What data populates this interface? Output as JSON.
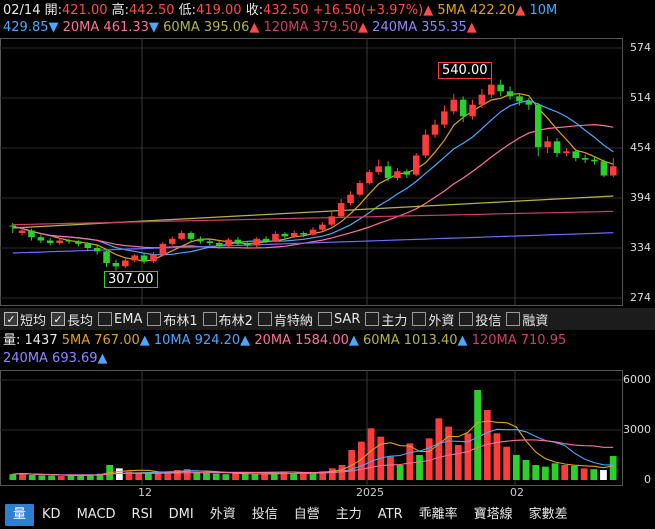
{
  "header": {
    "date": "02/14",
    "open_label": "開:",
    "open": "421.00",
    "high_label": "高:",
    "high": "442.50",
    "low_label": "低:",
    "low": "419.00",
    "close_label": "收:",
    "close": "432.50",
    "change": "+16.50(+3.97%)",
    "ma5": "5MA 422.20",
    "ma10_a": "10M",
    "ma10_b": "429.85",
    "ma20": "20MA 461.33",
    "ma60": "60MA 395.06",
    "ma120": "120MA 379.50",
    "ma240": "240MA 355.35",
    "up_arrow": "▲",
    "down_arrow": "▼"
  },
  "price_axis": [
    "574",
    "514",
    "454",
    "394",
    "334",
    "274"
  ],
  "annotations": {
    "high_mark": "540.00",
    "low_mark": "307.00"
  },
  "indicator_toggles": [
    {
      "label": "短均",
      "checked": true
    },
    {
      "label": "長均",
      "checked": true
    },
    {
      "label": "EMA",
      "checked": false
    },
    {
      "label": "布林1",
      "checked": false
    },
    {
      "label": "布林2",
      "checked": false
    },
    {
      "label": "肯特納",
      "checked": false
    },
    {
      "label": "SAR",
      "checked": false
    },
    {
      "label": "主力",
      "checked": false
    },
    {
      "label": "外資",
      "checked": false
    },
    {
      "label": "投信",
      "checked": false
    },
    {
      "label": "融資",
      "checked": false
    }
  ],
  "volume_header": {
    "vol": "量: 1437",
    "v5": "5MA 767.00",
    "v10": "10MA 924.20",
    "v20": "20MA 1584.00",
    "v60": "60MA 1013.40",
    "v120": "120MA 710.95",
    "v240": "240MA 693.69",
    "up_arrow": "▲"
  },
  "volume_axis": [
    "6000",
    "3000",
    "0"
  ],
  "x_axis": [
    "12",
    "2025",
    "02"
  ],
  "bottom_tabs": [
    "量",
    "KD",
    "MACD",
    "RSI",
    "DMI",
    "外資",
    "投信",
    "自營",
    "主力",
    "ATR",
    "乖離率",
    "寶塔線",
    "家數差"
  ],
  "colors": {
    "up": "#ff3b3b",
    "down": "#2bd12b",
    "ma5": "#e0a21a",
    "ma10": "#4aa8ff",
    "ma20": "#ff6fa0",
    "ma60": "#b5b24a",
    "ma120": "#d13c6b",
    "ma240": "#6b6bff",
    "accent_tab": "#2f7fd1"
  },
  "chart_data": {
    "type": "candlestick",
    "price_range": [
      274,
      574
    ],
    "candles": [
      [
        361,
        360,
        364,
        352
      ],
      [
        352,
        355,
        359,
        349
      ],
      [
        355,
        347,
        357,
        343
      ],
      [
        347,
        343,
        350,
        340
      ],
      [
        343,
        340,
        346,
        337
      ],
      [
        340,
        343,
        346,
        338
      ],
      [
        343,
        342,
        345,
        339
      ],
      [
        342,
        339,
        344,
        336
      ],
      [
        339,
        334,
        341,
        330
      ],
      [
        334,
        330,
        337,
        326
      ],
      [
        330,
        316,
        332,
        311
      ],
      [
        316,
        312,
        320,
        307
      ],
      [
        312,
        319,
        322,
        310
      ],
      [
        319,
        325,
        327,
        317
      ],
      [
        325,
        318,
        328,
        315
      ],
      [
        318,
        326,
        329,
        316
      ],
      [
        326,
        339,
        341,
        324
      ],
      [
        339,
        345,
        348,
        337
      ],
      [
        345,
        352,
        355,
        343
      ],
      [
        352,
        345,
        354,
        341
      ],
      [
        345,
        342,
        348,
        339
      ],
      [
        342,
        340,
        345,
        337
      ],
      [
        340,
        336,
        342,
        333
      ],
      [
        336,
        344,
        346,
        334
      ],
      [
        344,
        339,
        347,
        337
      ],
      [
        339,
        337,
        341,
        334
      ],
      [
        337,
        345,
        347,
        335
      ],
      [
        345,
        342,
        348,
        340
      ],
      [
        342,
        351,
        354,
        341
      ],
      [
        351,
        348,
        353,
        345
      ],
      [
        348,
        352,
        355,
        346
      ],
      [
        352,
        350,
        354,
        347
      ],
      [
        350,
        356,
        359,
        349
      ],
      [
        356,
        362,
        365,
        354
      ],
      [
        362,
        372,
        378,
        360
      ],
      [
        372,
        388,
        393,
        370
      ],
      [
        388,
        398,
        402,
        385
      ],
      [
        398,
        412,
        415,
        396
      ],
      [
        412,
        425,
        428,
        410
      ],
      [
        425,
        432,
        440,
        422
      ],
      [
        432,
        418,
        438,
        414
      ],
      [
        418,
        426,
        430,
        415
      ],
      [
        426,
        422,
        429,
        418
      ],
      [
        422,
        445,
        448,
        420
      ],
      [
        445,
        470,
        476,
        442
      ],
      [
        470,
        482,
        488,
        466
      ],
      [
        482,
        498,
        505,
        478
      ],
      [
        498,
        512,
        519,
        494
      ],
      [
        512,
        492,
        516,
        485
      ],
      [
        492,
        506,
        512,
        488
      ],
      [
        506,
        518,
        525,
        502
      ],
      [
        518,
        530,
        540,
        514
      ],
      [
        530,
        522,
        536,
        516
      ],
      [
        522,
        516,
        528,
        512
      ],
      [
        516,
        510,
        520,
        505
      ],
      [
        510,
        506,
        514,
        500
      ],
      [
        506,
        455,
        508,
        444
      ],
      [
        455,
        462,
        468,
        448
      ],
      [
        462,
        448,
        466,
        443
      ],
      [
        448,
        450,
        454,
        444
      ],
      [
        450,
        442,
        452,
        438
      ],
      [
        442,
        440,
        446,
        436
      ],
      [
        440,
        438,
        443,
        434
      ],
      [
        438,
        421,
        440,
        419
      ],
      [
        421,
        432,
        442,
        419
      ]
    ],
    "volumes": [
      350,
      420,
      300,
      280,
      260,
      240,
      300,
      280,
      320,
      380,
      900,
      700,
      500,
      420,
      380,
      450,
      520,
      600,
      650,
      480,
      420,
      380,
      350,
      400,
      360,
      330,
      400,
      380,
      450,
      420,
      480,
      460,
      520,
      700,
      900,
      1800,
      2300,
      3100,
      2600,
      1400,
      900,
      2200,
      1500,
      2500,
      3700,
      3200,
      2100,
      2800,
      5400,
      4200,
      2800,
      2000,
      1500,
      1200,
      900,
      800,
      1000,
      900,
      850,
      700,
      650,
      600,
      1437
    ],
    "volume_range": [
      0,
      6000
    ],
    "x_ticks": [
      "12",
      "2025",
      "02"
    ]
  }
}
